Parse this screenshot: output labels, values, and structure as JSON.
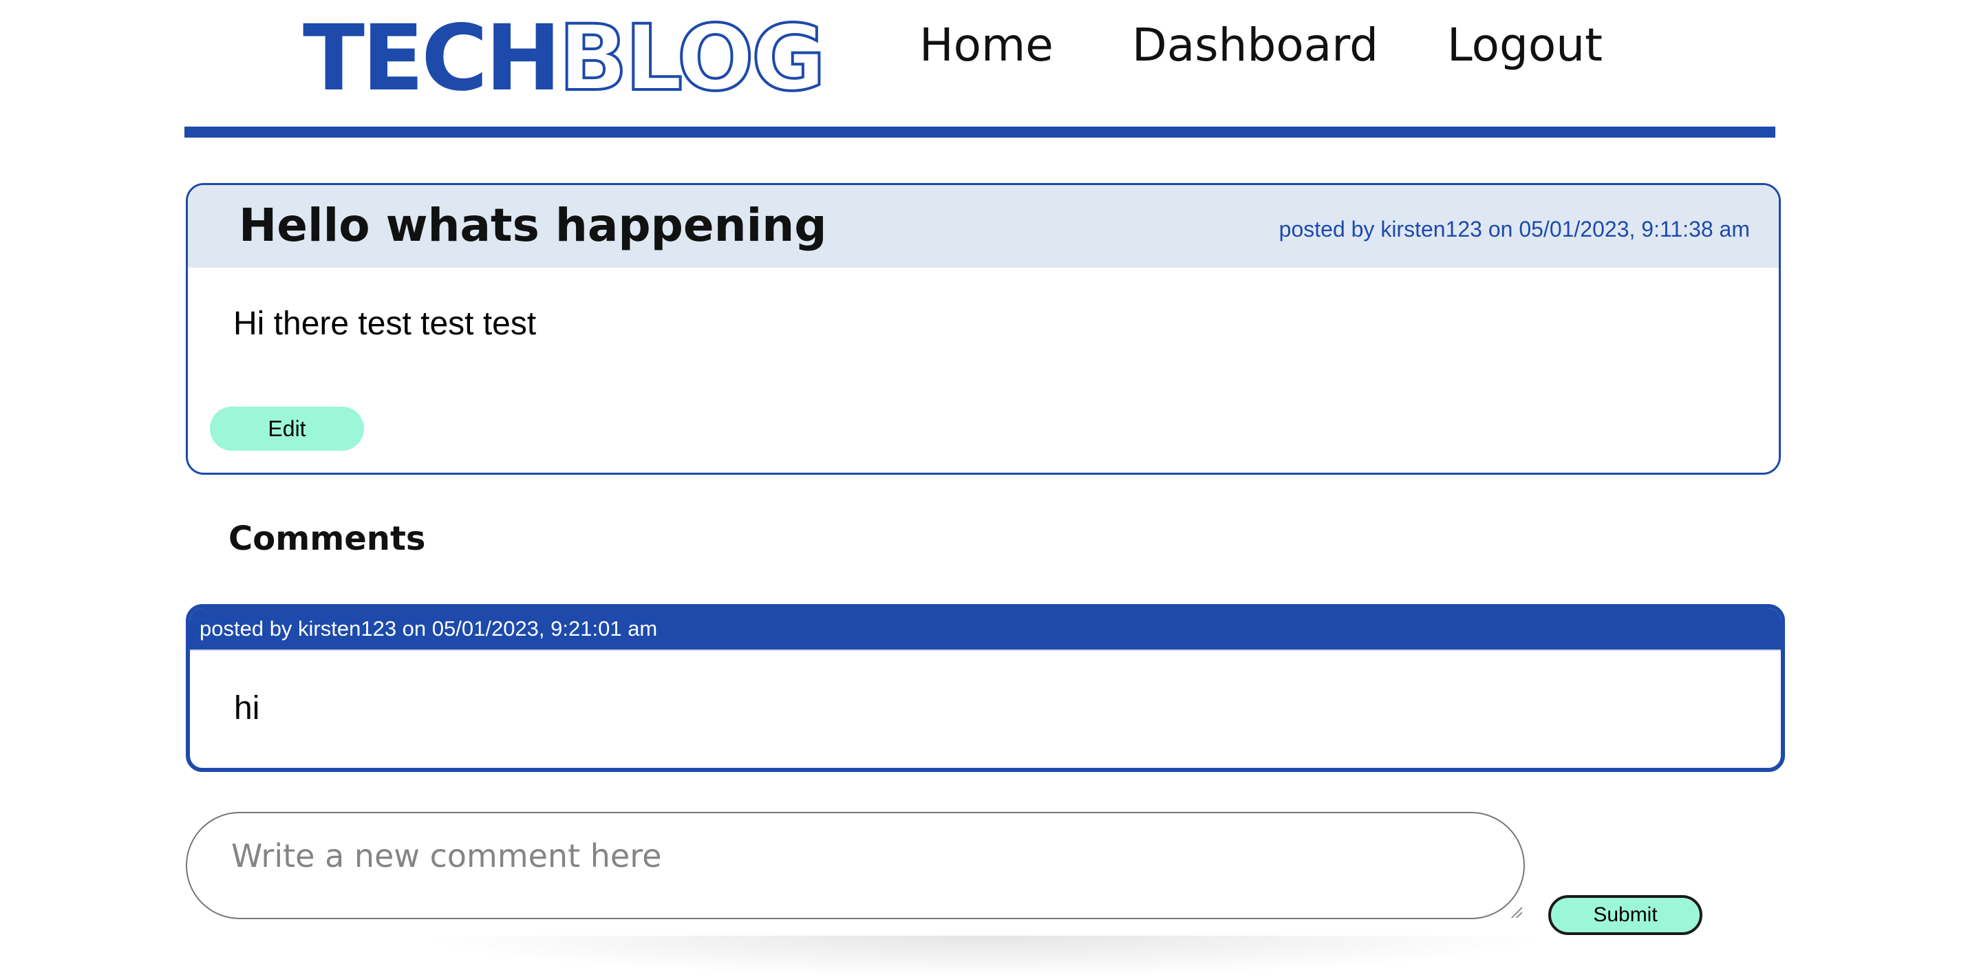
{
  "header": {
    "logo": {
      "solid": "TECH",
      "outline": "BLOG"
    },
    "nav": {
      "home": "Home",
      "dashboard": "Dashboard",
      "logout": "Logout"
    }
  },
  "post": {
    "title": "Hello whats happening",
    "meta": "posted by kirsten123 on 05/01/2023, 9:11:38 am",
    "body": "Hi there test test test",
    "edit_label": "Edit"
  },
  "comments": {
    "heading": "Comments",
    "items": [
      {
        "meta": "posted by kirsten123 on 05/01/2023, 9:21:01 am",
        "text": "hi"
      }
    ]
  },
  "comment_form": {
    "placeholder": "Write a new comment here",
    "value": "",
    "submit_label": "Submit"
  },
  "colors": {
    "brand": "#1d4aab",
    "post_header_bg": "#dfe8f2",
    "button_bg": "#9bf7d8"
  }
}
